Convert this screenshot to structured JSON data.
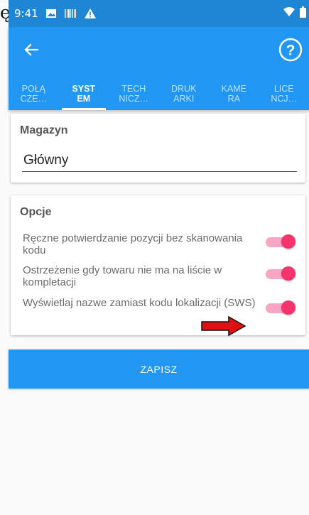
{
  "page_mark": "ę",
  "status_bar": {
    "time": "9:41"
  },
  "tabs": [
    {
      "line1": "POŁĄ",
      "line2": "CZE…",
      "active": false
    },
    {
      "line1": "SYST",
      "line2": "EM",
      "active": true
    },
    {
      "line1": "TECH",
      "line2": "NICZ…",
      "active": false
    },
    {
      "line1": "DRUK",
      "line2": "ARKI",
      "active": false
    },
    {
      "line1": "KAME",
      "line2": "RA",
      "active": false
    },
    {
      "line1": "LICE",
      "line2": "NCJ…",
      "active": false
    }
  ],
  "magazyn": {
    "title": "Magazyn",
    "value": "Główny"
  },
  "opcje": {
    "title": "Opcje",
    "options": [
      {
        "label": "Ręczne potwierdzanie pozycji bez skanowania kodu",
        "enabled": true
      },
      {
        "label": "Ostrzeżenie gdy towaru nie ma na liście w kompletacji",
        "enabled": true
      },
      {
        "label": "Wyświetlaj nazwe zamiast kodu lokalizacji (SWS)",
        "enabled": true
      }
    ]
  },
  "save_label": "ZAPISZ",
  "colors": {
    "primary": "#2196f3",
    "status": "#1f86d6",
    "switch_on": "#f7336c",
    "arrow": "#e01010"
  },
  "icons": [
    "image-icon",
    "barcode-icon",
    "warning-icon",
    "wifi-icon",
    "battery-icon",
    "back-arrow-icon",
    "help-icon",
    "red-arrow-icon"
  ]
}
